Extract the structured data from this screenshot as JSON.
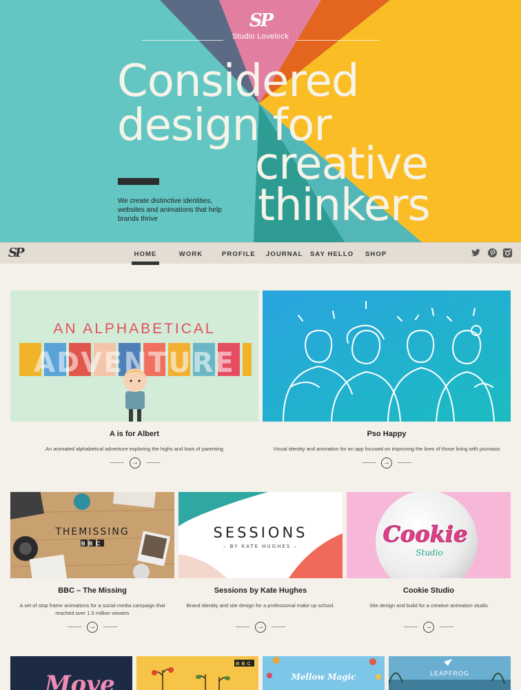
{
  "site": {
    "logo_mark": "SP",
    "brand": "Studio Lovelock"
  },
  "hero": {
    "line1": "Considered",
    "line2": "design for",
    "line3": "creative",
    "line4": "thinkers",
    "tagline": "We create distinctive identities, websites and animations that help brands thrive",
    "colors": {
      "teal": "#63c6c3",
      "pink": "#e27fa0",
      "slate": "#5b6a85",
      "orange": "#e4651e",
      "yellow": "#fbbd26",
      "dark_teal": "#2e9c93",
      "mid_teal": "#54b7b7"
    }
  },
  "nav": {
    "logo": "SP",
    "items": [
      "HOME",
      "WORK",
      "PROFILE",
      "JOURNAL",
      "SAY HELLO",
      "SHOP"
    ],
    "social": [
      "twitter-icon",
      "pinterest-icon",
      "instagram-icon"
    ]
  },
  "projects": [
    {
      "title": "A is for Albert",
      "desc": "An animated alphabetical adventure exploring the highs and lows of parenting",
      "img_line1": "AN ALPHABETICAL",
      "img_line2": "ADVENTURE"
    },
    {
      "title": "Pso Happy",
      "desc": "Visual identity and animation for an app focused on improving the lives of those living with psoriasis"
    },
    {
      "title": "BBC – The Missing",
      "desc": "A set of stop frame animations for a social media campaign that reached over 1.5 million viewers",
      "img_line1": "THEMISSING",
      "img_line2": "BBC"
    },
    {
      "title": "Sessions by Kate Hughes",
      "desc": "Brand identity and site design for a professional make up school.",
      "img_line1": "SESSIONS",
      "img_line2": "– BY KATE HUGHES –"
    },
    {
      "title": "Cookie Studio",
      "desc": "Site design and build for a creative animation studio",
      "img_line1": "Cookie",
      "img_line2": "Studio"
    }
  ],
  "bottom_thumbs": [
    {
      "text": "Move"
    },
    {
      "text": "BBC"
    },
    {
      "text": "Mellow Magic"
    },
    {
      "text": "LEAPFROG"
    }
  ]
}
